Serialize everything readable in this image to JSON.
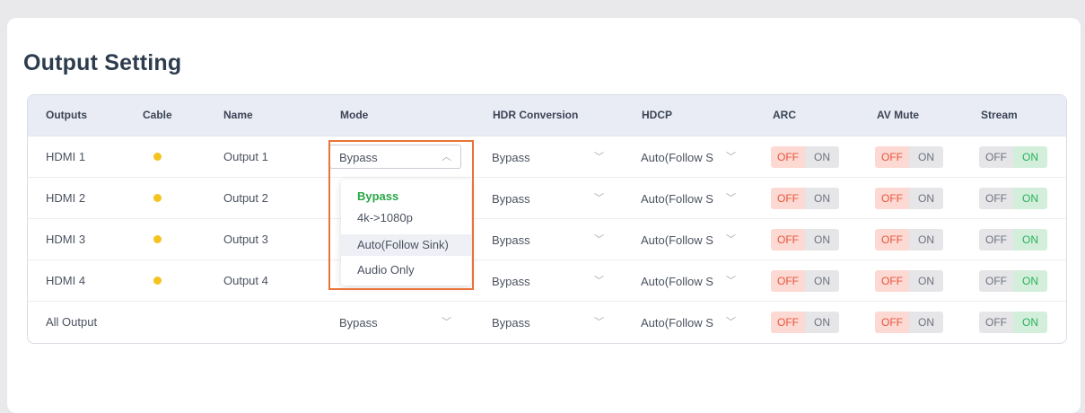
{
  "page": {
    "title": "Output Setting"
  },
  "columns": [
    "Outputs",
    "Cable",
    "Name",
    "Mode",
    "HDR Conversion",
    "HDCP",
    "ARC",
    "AV Mute",
    "Stream"
  ],
  "rows": [
    {
      "output": "HDMI 1",
      "cable": "connected",
      "name": "Output 1",
      "mode": "Bypass",
      "hdr": "Bypass",
      "hdcp": "Auto(Follow S",
      "arc": "OFF",
      "av_mute": "OFF",
      "stream": "ON"
    },
    {
      "output": "HDMI 2",
      "cable": "connected",
      "name": "Output 2",
      "mode": "",
      "hdr": "Bypass",
      "hdcp": "Auto(Follow S",
      "arc": "OFF",
      "av_mute": "OFF",
      "stream": "ON"
    },
    {
      "output": "HDMI 3",
      "cable": "connected",
      "name": "Output 3",
      "mode": "",
      "hdr": "Bypass",
      "hdcp": "Auto(Follow S",
      "arc": "OFF",
      "av_mute": "OFF",
      "stream": "ON"
    },
    {
      "output": "HDMI 4",
      "cable": "connected",
      "name": "Output 4",
      "mode": "",
      "hdr": "Bypass",
      "hdcp": "Auto(Follow S",
      "arc": "OFF",
      "av_mute": "OFF",
      "stream": "ON"
    },
    {
      "output": "All Output",
      "cable": "",
      "name": "",
      "mode": "Bypass",
      "hdr": "Bypass",
      "hdcp": "Auto(Follow S",
      "arc": "OFF",
      "av_mute": "OFF",
      "stream": "ON"
    }
  ],
  "toggle_labels": {
    "off": "OFF",
    "on": "ON"
  },
  "mode_dropdown": {
    "open_for": "HDMI 1",
    "options": [
      "Bypass",
      "4k->1080p",
      "Auto(Follow Sink)",
      "Audio Only"
    ],
    "selected": "Bypass",
    "hovered": "Auto(Follow Sink)"
  },
  "icons": {
    "select_arrow": "chevron-down-icon",
    "select_open_arrow": "chevron-up-icon",
    "cable_status": "status-dot-icon"
  },
  "colors": {
    "cable_dot": "#f4c31f",
    "off_active": "#e8543c",
    "on_active": "#2ab05a",
    "selected_option": "#28a745",
    "highlight": "#e9733a"
  }
}
